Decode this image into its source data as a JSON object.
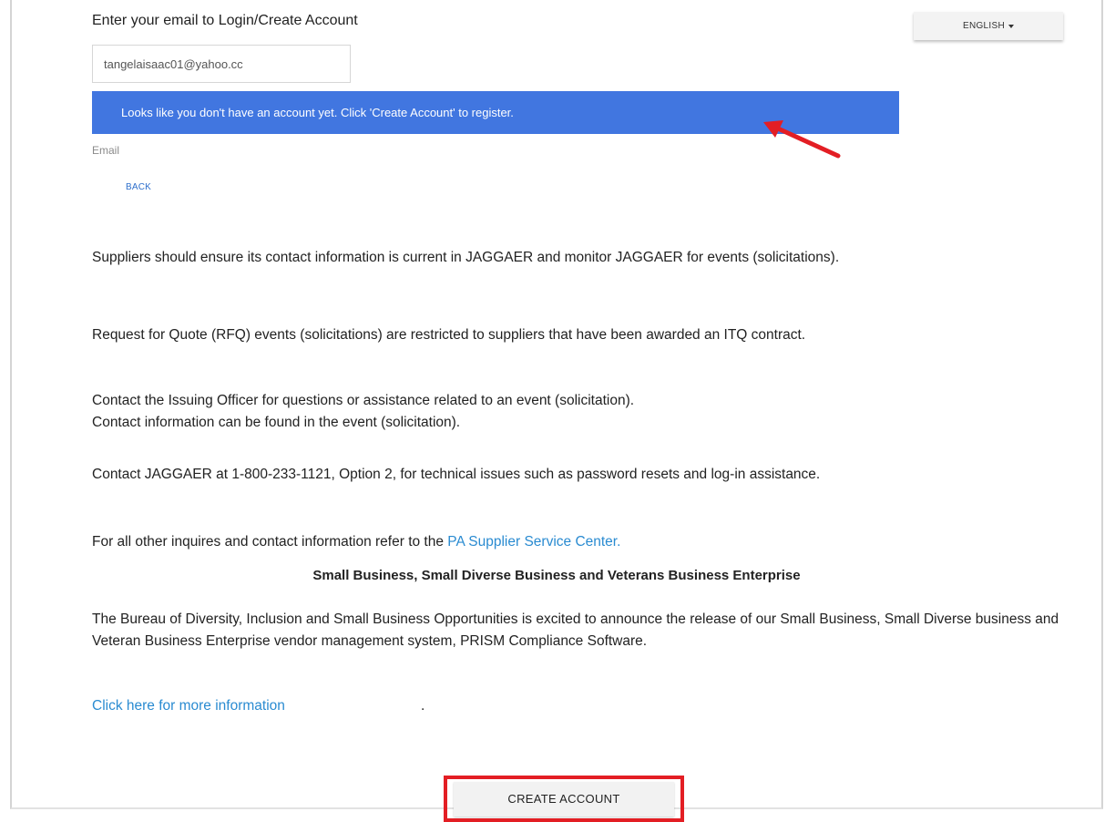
{
  "login": {
    "title": "Enter your email to Login/Create Account",
    "email_value": "tangelaisaac01@yahoo.cc",
    "email_label": "Email",
    "back_label": "BACK"
  },
  "language": {
    "selected": "ENGLISH"
  },
  "notice": {
    "text": "Looks like you don't have an account yet. Click 'Create Account' to register.",
    "color": "#4176e0"
  },
  "content": {
    "p1": "Suppliers should ensure its contact information is current in JAGGAER and monitor JAGGAER for events (solicitations).",
    "p2": "Request for Quote (RFQ) events (solicitations) are restricted to suppliers that have been awarded an ITQ contract.",
    "p3_line1": "Contact the Issuing Officer for questions or assistance related to an event (solicitation).",
    "p3_line2": "Contact information can be found in the event (solicitation).",
    "p4": "Contact JAGGAER at 1-800-233-1121, Option 2, for technical issues such as password resets and log-in assistance.",
    "p5_text": "For all other inquires and contact information refer to the",
    "p5_link": "PA Supplier Service Center.",
    "sb_heading": "Small Business, Small Diverse Business and Veterans Business Enterprise",
    "p6": "The Bureau of Diversity, Inclusion and Small Business Opportunities is excited to announce the release of our Small Business, Small Diverse business and Veteran Business Enterprise vendor management system, PRISM Compliance Software.",
    "more_link": "Click here for more information",
    "more_suffix": "."
  },
  "actions": {
    "create_account": "CREATE ACCOUNT"
  },
  "colors": {
    "link": "#2a8bd1",
    "highlight_box": "#e31e24",
    "arrow": "#e31e24"
  },
  "icons": {
    "language_caret": "chevron-down-icon",
    "annotation_arrow": "arrow-icon"
  }
}
